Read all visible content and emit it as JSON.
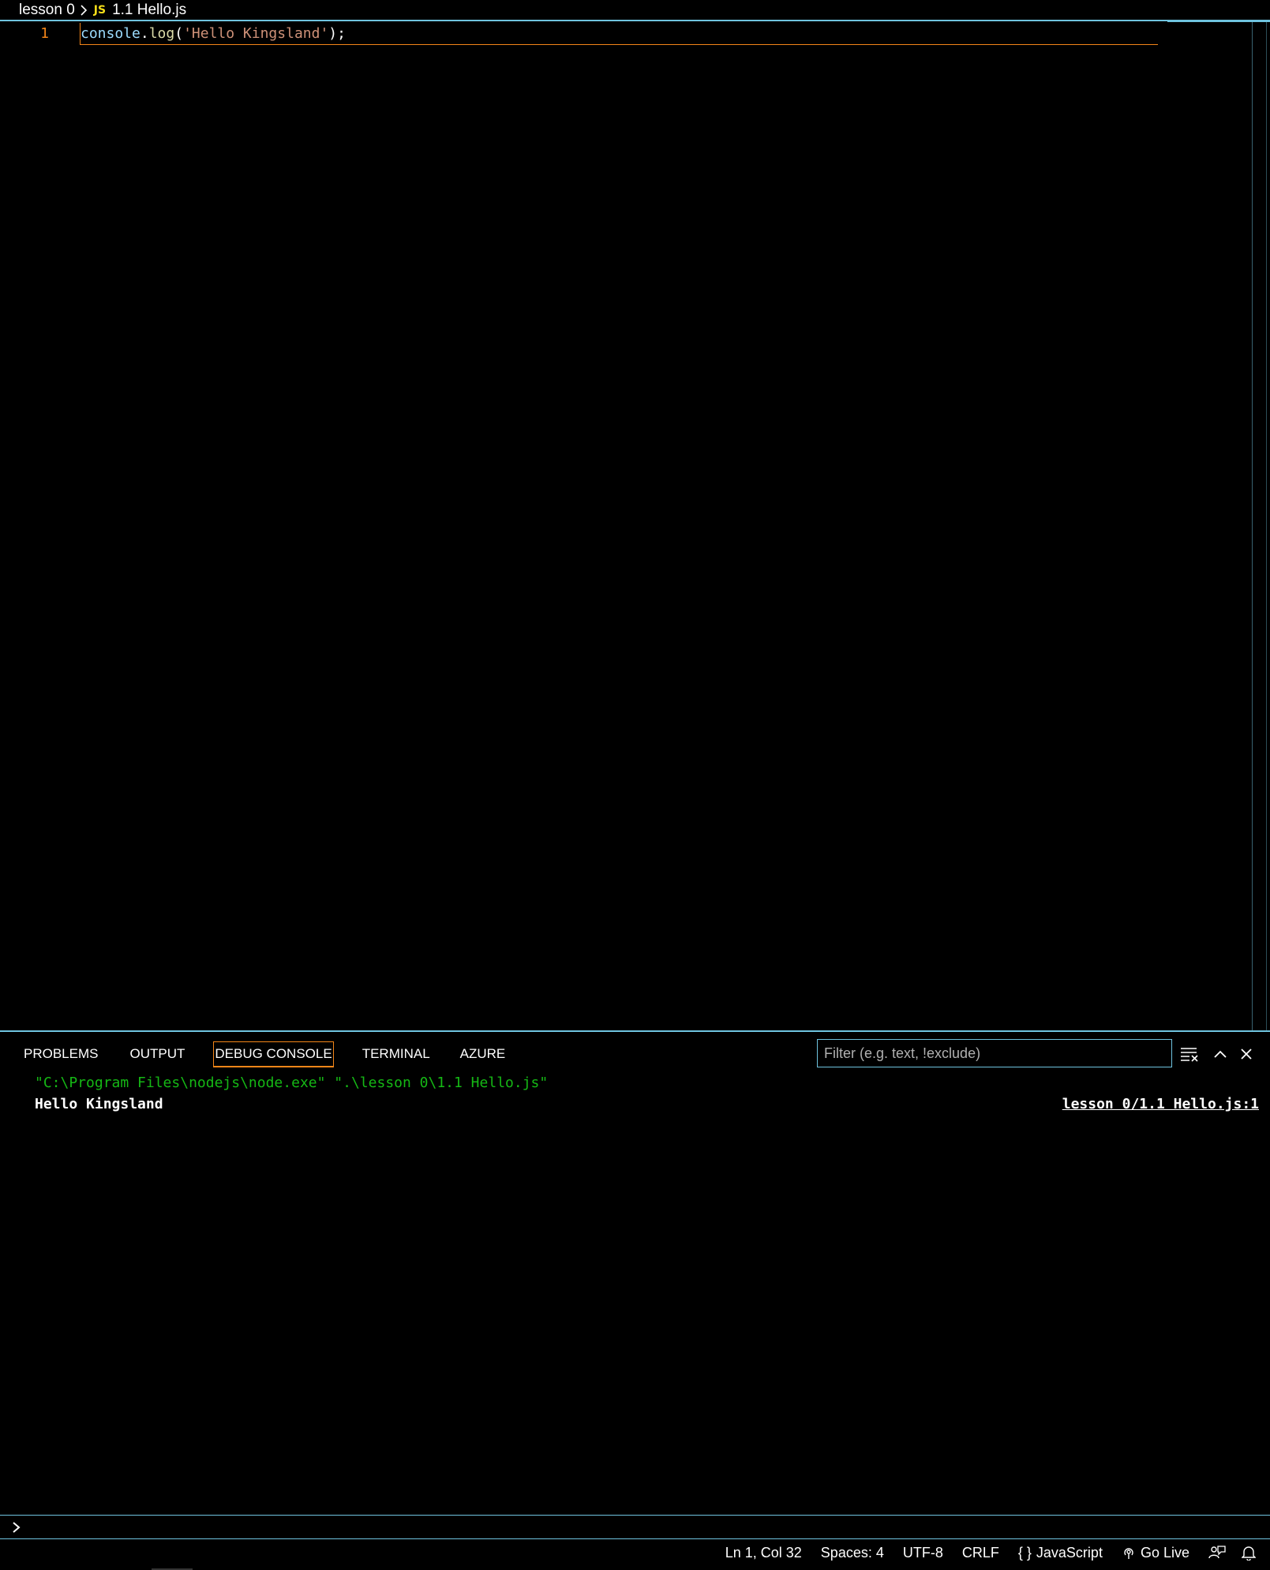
{
  "breadcrumb": {
    "folder": "lesson 0",
    "file_icon": "JS",
    "file": "1.1 Hello.js"
  },
  "editor": {
    "line_number": "1",
    "code": {
      "obj": "console",
      "dot": ".",
      "fn": "log",
      "open": "(",
      "str": "'Hello Kingsland'",
      "close": ");"
    }
  },
  "panel": {
    "tabs": [
      {
        "label": "PROBLEMS"
      },
      {
        "label": "OUTPUT"
      },
      {
        "label": "DEBUG CONSOLE",
        "active": true
      },
      {
        "label": "TERMINAL"
      },
      {
        "label": "AZURE"
      }
    ],
    "filter_placeholder": "Filter (e.g. text, !exclude)",
    "console": {
      "command": "\"C:\\Program Files\\nodejs\\node.exe\" \".\\lesson 0\\1.1 Hello.js\"",
      "output": "Hello Kingsland",
      "source": "lesson 0/1.1 Hello.js:1"
    }
  },
  "statusbar": {
    "position": "Ln 1, Col 32",
    "spaces": "Spaces: 4",
    "encoding": "UTF-8",
    "eol": "CRLF",
    "language_icon": "{ }",
    "language": "JavaScript",
    "golive": "Go Live"
  },
  "colors": {
    "accent": "#6fc3df",
    "focus": "#f38518",
    "string": "#ce9178",
    "console_cmd": "#15b815"
  }
}
